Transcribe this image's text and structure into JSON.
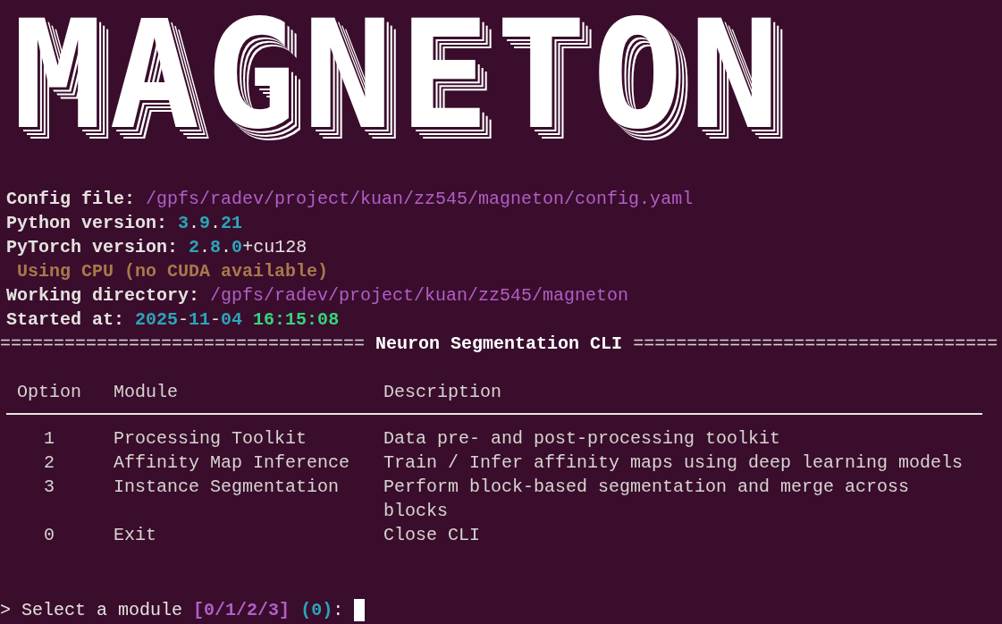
{
  "logo": "MAGNETON",
  "info_lines": [
    {
      "segments": [
        {
          "kind": "label",
          "text": "Config file: "
        },
        {
          "kind": "path",
          "text": "/gpfs/radev/project/kuan/zz545/magneton/config.yaml"
        }
      ]
    },
    {
      "segments": [
        {
          "kind": "label",
          "text": "Python version: "
        },
        {
          "kind": "number",
          "text": "3"
        },
        {
          "kind": "plain",
          "text": "."
        },
        {
          "kind": "number",
          "text": "9"
        },
        {
          "kind": "plain",
          "text": "."
        },
        {
          "kind": "number",
          "text": "21"
        }
      ]
    },
    {
      "segments": [
        {
          "kind": "label",
          "text": "PyTorch version: "
        },
        {
          "kind": "number",
          "text": "2"
        },
        {
          "kind": "plain",
          "text": "."
        },
        {
          "kind": "number",
          "text": "8"
        },
        {
          "kind": "plain",
          "text": "."
        },
        {
          "kind": "number",
          "text": "0"
        },
        {
          "kind": "plain",
          "text": "+cu128"
        }
      ]
    },
    {
      "segments": [
        {
          "kind": "warning",
          "text": " Using CPU (no CUDA available)"
        }
      ]
    },
    {
      "segments": [
        {
          "kind": "label",
          "text": "Working directory: "
        },
        {
          "kind": "path",
          "text": "/gpfs/radev/project/kuan/zz545/magneton"
        }
      ]
    },
    {
      "segments": [
        {
          "kind": "label",
          "text": "Started at: "
        },
        {
          "kind": "number",
          "text": "2025"
        },
        {
          "kind": "plain",
          "text": "-"
        },
        {
          "kind": "number",
          "text": "11"
        },
        {
          "kind": "plain",
          "text": "-"
        },
        {
          "kind": "number",
          "text": "04"
        },
        {
          "kind": "time",
          "text": " 16:15:08"
        }
      ]
    }
  ],
  "banner": {
    "rule_left": "==================================",
    "title": "Neuron Segmentation CLI",
    "rule_right": "=================================="
  },
  "table": {
    "columns": [
      "Option",
      "Module",
      "Description"
    ],
    "rows": [
      {
        "option": "1",
        "module": "Processing Toolkit",
        "description": "Data pre- and post-processing toolkit"
      },
      {
        "option": "2",
        "module": "Affinity Map Inference",
        "description": "Train / Infer affinity maps using deep learning models"
      },
      {
        "option": "3",
        "module": "Instance Segmentation",
        "description": "Perform block-based segmentation and merge across blocks"
      },
      {
        "option": "0",
        "module": "Exit",
        "description": "Close CLI"
      }
    ]
  },
  "prompt": {
    "marker": ">",
    "text": "Select a module",
    "choices": "[0/1/2/3]",
    "default": "(0)",
    "colon": ":"
  }
}
